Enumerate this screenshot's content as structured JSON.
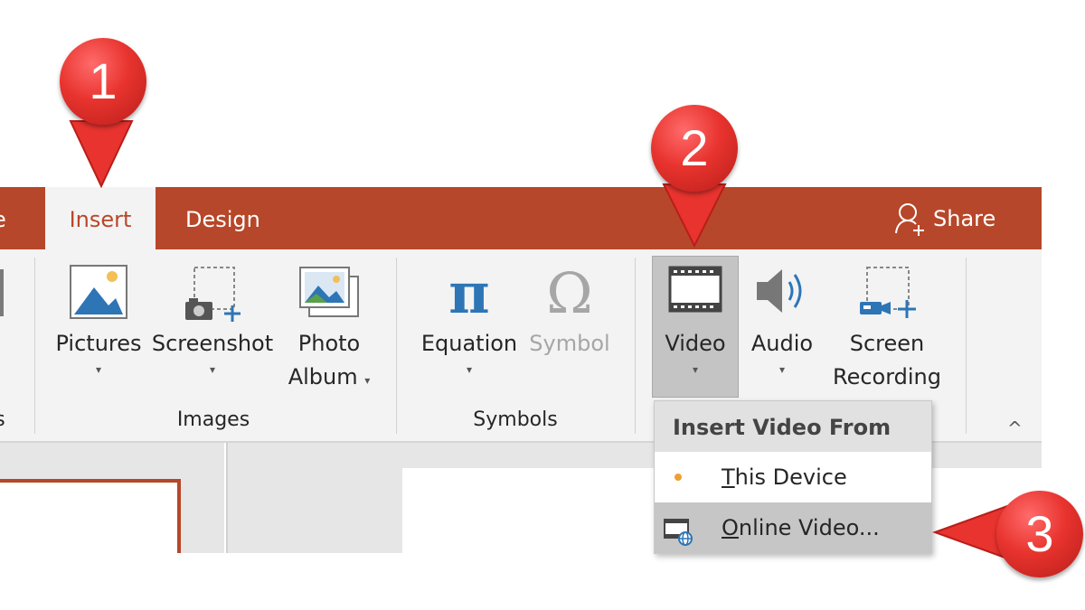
{
  "tabs": {
    "partial_label": "e",
    "insert_label": "Insert",
    "design_label": "Design",
    "share_label": "Share"
  },
  "ribbon": {
    "pictures_label": "Pictures",
    "screenshot_label": "Screenshot",
    "photo_album_line1": "Photo",
    "photo_album_line2": "Album",
    "equation_label": "Equation",
    "symbol_label": "Symbol",
    "video_label": "Video",
    "audio_label": "Audio",
    "screen_recording_line1": "Screen",
    "screen_recording_line2": "Recording",
    "caret": "▾",
    "groups": {
      "partial": "s",
      "images": "Images",
      "symbols": "Symbols"
    },
    "collapse_glyph": "^"
  },
  "dropdown": {
    "header": "Insert Video From",
    "items": [
      {
        "access_key": "T",
        "rest": "his Device"
      },
      {
        "access_key": "O",
        "rest": "nline Video..."
      }
    ]
  },
  "callouts": [
    "1",
    "2",
    "3"
  ],
  "colors": {
    "brand": "#b7472a",
    "ribbon_bg": "#f3f3f3",
    "callout_red": "#e8332e",
    "device_dot": "#f0a030",
    "icon_blue": "#2e75b6"
  },
  "icons": {
    "share": "person-plus-icon",
    "pictures": "image-icon",
    "screenshot": "camera-plus-icon",
    "photo_album": "photo-album-icon",
    "equation": "pi-icon",
    "symbol": "omega-icon",
    "video": "film-icon",
    "audio": "speaker-icon",
    "screen_recording": "screen-record-icon",
    "online_video": "online-video-icon"
  }
}
